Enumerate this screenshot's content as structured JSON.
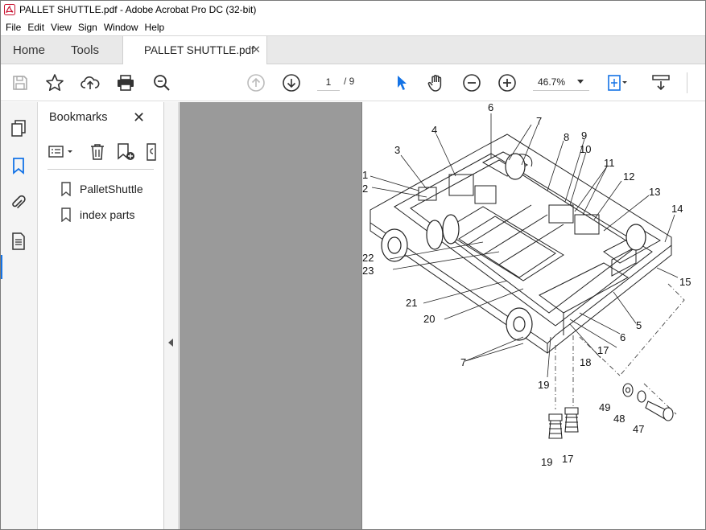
{
  "window": {
    "title": "PALLET SHUTTLE.pdf - Adobe Acrobat Pro DC (32-bit)"
  },
  "menu": [
    "File",
    "Edit",
    "View",
    "Sign",
    "Window",
    "Help"
  ],
  "tabs": {
    "home": "Home",
    "tools": "Tools",
    "document": "PALLET SHUTTLE.pdf"
  },
  "toolbar": {
    "icons": [
      "save-icon",
      "bookmark-star-icon",
      "upload-icon",
      "print-icon",
      "zoom-search-icon",
      "prev-page-icon",
      "next-page-icon",
      "select-cursor-icon",
      "hand-icon",
      "zoom-out-icon",
      "zoom-in-icon",
      "fit-page-icon",
      "scroll-mode-icon"
    ],
    "page_current": "1",
    "page_total": "/ 9",
    "zoom": "46.7%"
  },
  "sidebar": {
    "title": "Bookmarks",
    "items": [
      {
        "label": "PalletShuttle"
      },
      {
        "label": "index parts"
      }
    ]
  },
  "drawing": {
    "callouts": [
      "1",
      "2",
      "3",
      "4",
      "5",
      "6",
      "6",
      "7",
      "7",
      "8",
      "9",
      "10",
      "11",
      "12",
      "13",
      "14",
      "15",
      "17",
      "17",
      "18",
      "19",
      "19",
      "20",
      "21",
      "22",
      "23",
      "47",
      "48",
      "49"
    ]
  },
  "colors": {
    "accent": "#1473e6",
    "doc_bg": "#9a9a9a"
  }
}
